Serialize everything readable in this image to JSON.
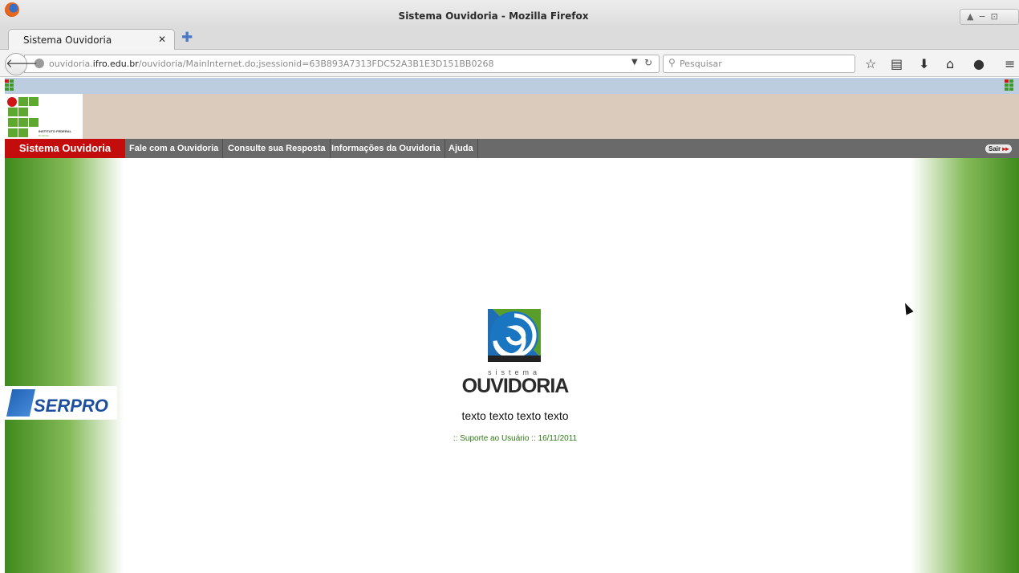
{
  "browser": {
    "window_title": "Sistema Ouvidoria - Mozilla Firefox",
    "tab_title": "Sistema Ouvidoria",
    "url_prefix": "ouvidoria.",
    "url_domain": "ifro.edu.br",
    "url_path": "/ouvidoria/MainInternet.do;jsessionid=63B893A7313FDC52A3B1E3D151BB0268",
    "search_placeholder": "Pesquisar",
    "toolbar_icons": [
      "bookmark-star-icon",
      "reading-list-icon",
      "download-icon",
      "home-icon",
      "chat-icon",
      "menu-icon"
    ]
  },
  "header": {
    "institution_name": "INSTITUTO FEDERAL",
    "institution_sub": "Rondônia"
  },
  "menu": {
    "brand": "Sistema Ouvidoria",
    "items": [
      {
        "label": "Fale com a Ouvidoria"
      },
      {
        "label": "Consulte sua Resposta"
      },
      {
        "label": "Informações da Ouvidoria"
      },
      {
        "label": "Ajuda"
      }
    ],
    "logout": "Sair"
  },
  "main": {
    "logo_top": "sistema",
    "logo_name": "OUVIDORIA",
    "text": "texto texto texto texto",
    "support": ":: Suporte ao Usuário :: 16/11/2011"
  },
  "partner": {
    "name": "SERPRO"
  },
  "colors": {
    "menu_brand": "#c30d0d",
    "menu_bg": "#6a6a6a",
    "header_band": "#dbcbbd",
    "side_green": "#3f8a1c",
    "support_text": "#2d7a14"
  }
}
